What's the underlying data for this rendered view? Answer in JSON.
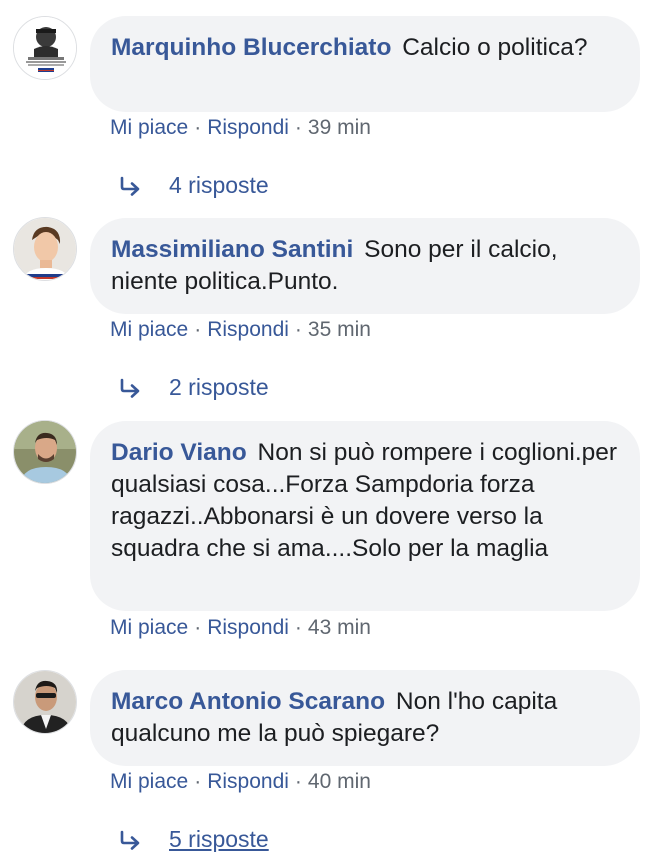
{
  "comments": [
    {
      "author": "Marquinho Blucerchiato",
      "text": "Calcio o politica?",
      "like_label": "Mi piace",
      "reply_label": "Rispondi",
      "time": "39 min",
      "replies_label": "4 risposte",
      "avatar_icon": "logo-avatar"
    },
    {
      "author": "Massimiliano Santini",
      "text": "Sono per il calcio, niente politica.Punto.",
      "like_label": "Mi piace",
      "reply_label": "Rispondi",
      "time": "35 min",
      "replies_label": "2 risposte",
      "avatar_icon": "person-avatar"
    },
    {
      "author": "Dario Viano",
      "text": "Non si può rompere i coglioni.per qualsiasi cosa...Forza Sampdoria forza ragazzi..Abbonarsi è un dovere verso la squadra che si ama....Solo per la maglia",
      "like_label": "Mi piace",
      "reply_label": "Rispondi",
      "time": "43 min",
      "avatar_icon": "person-avatar"
    },
    {
      "author": "Marco Antonio Scarano",
      "text": "Non l'ho capita qualcuno me la può spiegare?",
      "like_label": "Mi piace",
      "reply_label": "Rispondi",
      "time": "40 min",
      "replies_label": "5 risposte",
      "avatar_icon": "person-avatar"
    }
  ],
  "separator": "·",
  "colors": {
    "link": "#385898",
    "bubble": "#f2f3f5",
    "text": "#1c1e21",
    "meta": "#606770"
  }
}
